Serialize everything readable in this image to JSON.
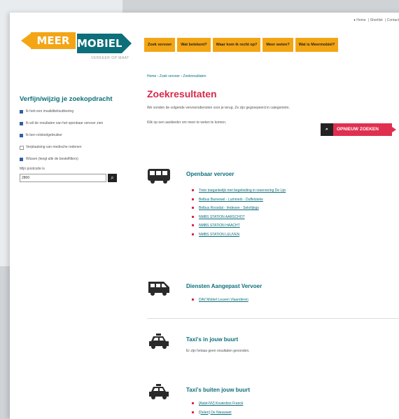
{
  "topnav": [
    "♦ Home",
    "| Shortlist",
    "| Contact"
  ],
  "logo": {
    "part1": "MEER",
    "part2": "MOBIEL",
    "tagline": "VERKEER OP MAAT"
  },
  "mainnav": [
    "Zoek vervoer",
    "Wat betekent?",
    "Waar kom ik recht op?",
    "Meer weten?",
    "Wat is Meermobiel?"
  ],
  "sidebar": {
    "title": "Verfijn/wijzig je zoekopdracht",
    "filters": [
      {
        "label": "Ik heb een invaliditeitsuitkering",
        "checked": true
      },
      {
        "label": "Ik wil de resultaten van het openbaar vervoer zien",
        "checked": true
      },
      {
        "label": "Ik ben rolstoelgebruiker",
        "checked": true
      },
      {
        "label": "Verplaatsing van medische redenen",
        "checked": false
      },
      {
        "label": "Wissen (leegt alle de bestelfilters)",
        "checked": true
      }
    ],
    "postcode_label": "Mijn postcode is",
    "postcode_value": "2800",
    "search_icon": "search-icon"
  },
  "content": {
    "breadcrumb": "Home › Zoek vervoer › Zoekresultaten",
    "title": "Zoekresultaten",
    "intro": "We vonden de volgende vervoersdiensten voor je terug. Ze zijn gegroepeerd in categorieën.",
    "intro2": "Klik op een aanbieder om meer te weten te komen.",
    "new_search": "OPNIEUW ZOEKEN",
    "sections": [
      {
        "icon": "bus-icon",
        "title": "Openbaar vervoer",
        "items": [
          "Trein toegankelijk met begeleiding in reservering De Lijn",
          "Belbus Barnewel - Lummeln - Duffelsteke",
          "Belbus Roosdal - Imdesee - Sekrilijngs",
          "NMBS STATION AARSCHOT",
          "NMBS STATION HAACHT",
          "NMBS STATION LEUVEN"
        ]
      },
      {
        "icon": "van-icon",
        "title": "Diensten Aangepast Vervoer",
        "items": [
          "DAV Mobiel Leuven Vlaanderen"
        ]
      },
      {
        "icon": "taxi-icon",
        "title": "Taxi's in jouw buurt",
        "items": [],
        "empty_text": "Er zijn helaas geen resultaten gevonden."
      },
      {
        "icon": "taxi-icon",
        "title": "Taxi's buiten jouw buurt",
        "items": [
          "[Aalst-NV] Kouterbos Franck",
          "[Delen] De Nieuwwet"
        ]
      }
    ]
  },
  "colors": {
    "accent": "#d8294a",
    "teal": "#0c6f7a",
    "orange": "#f3a514"
  }
}
